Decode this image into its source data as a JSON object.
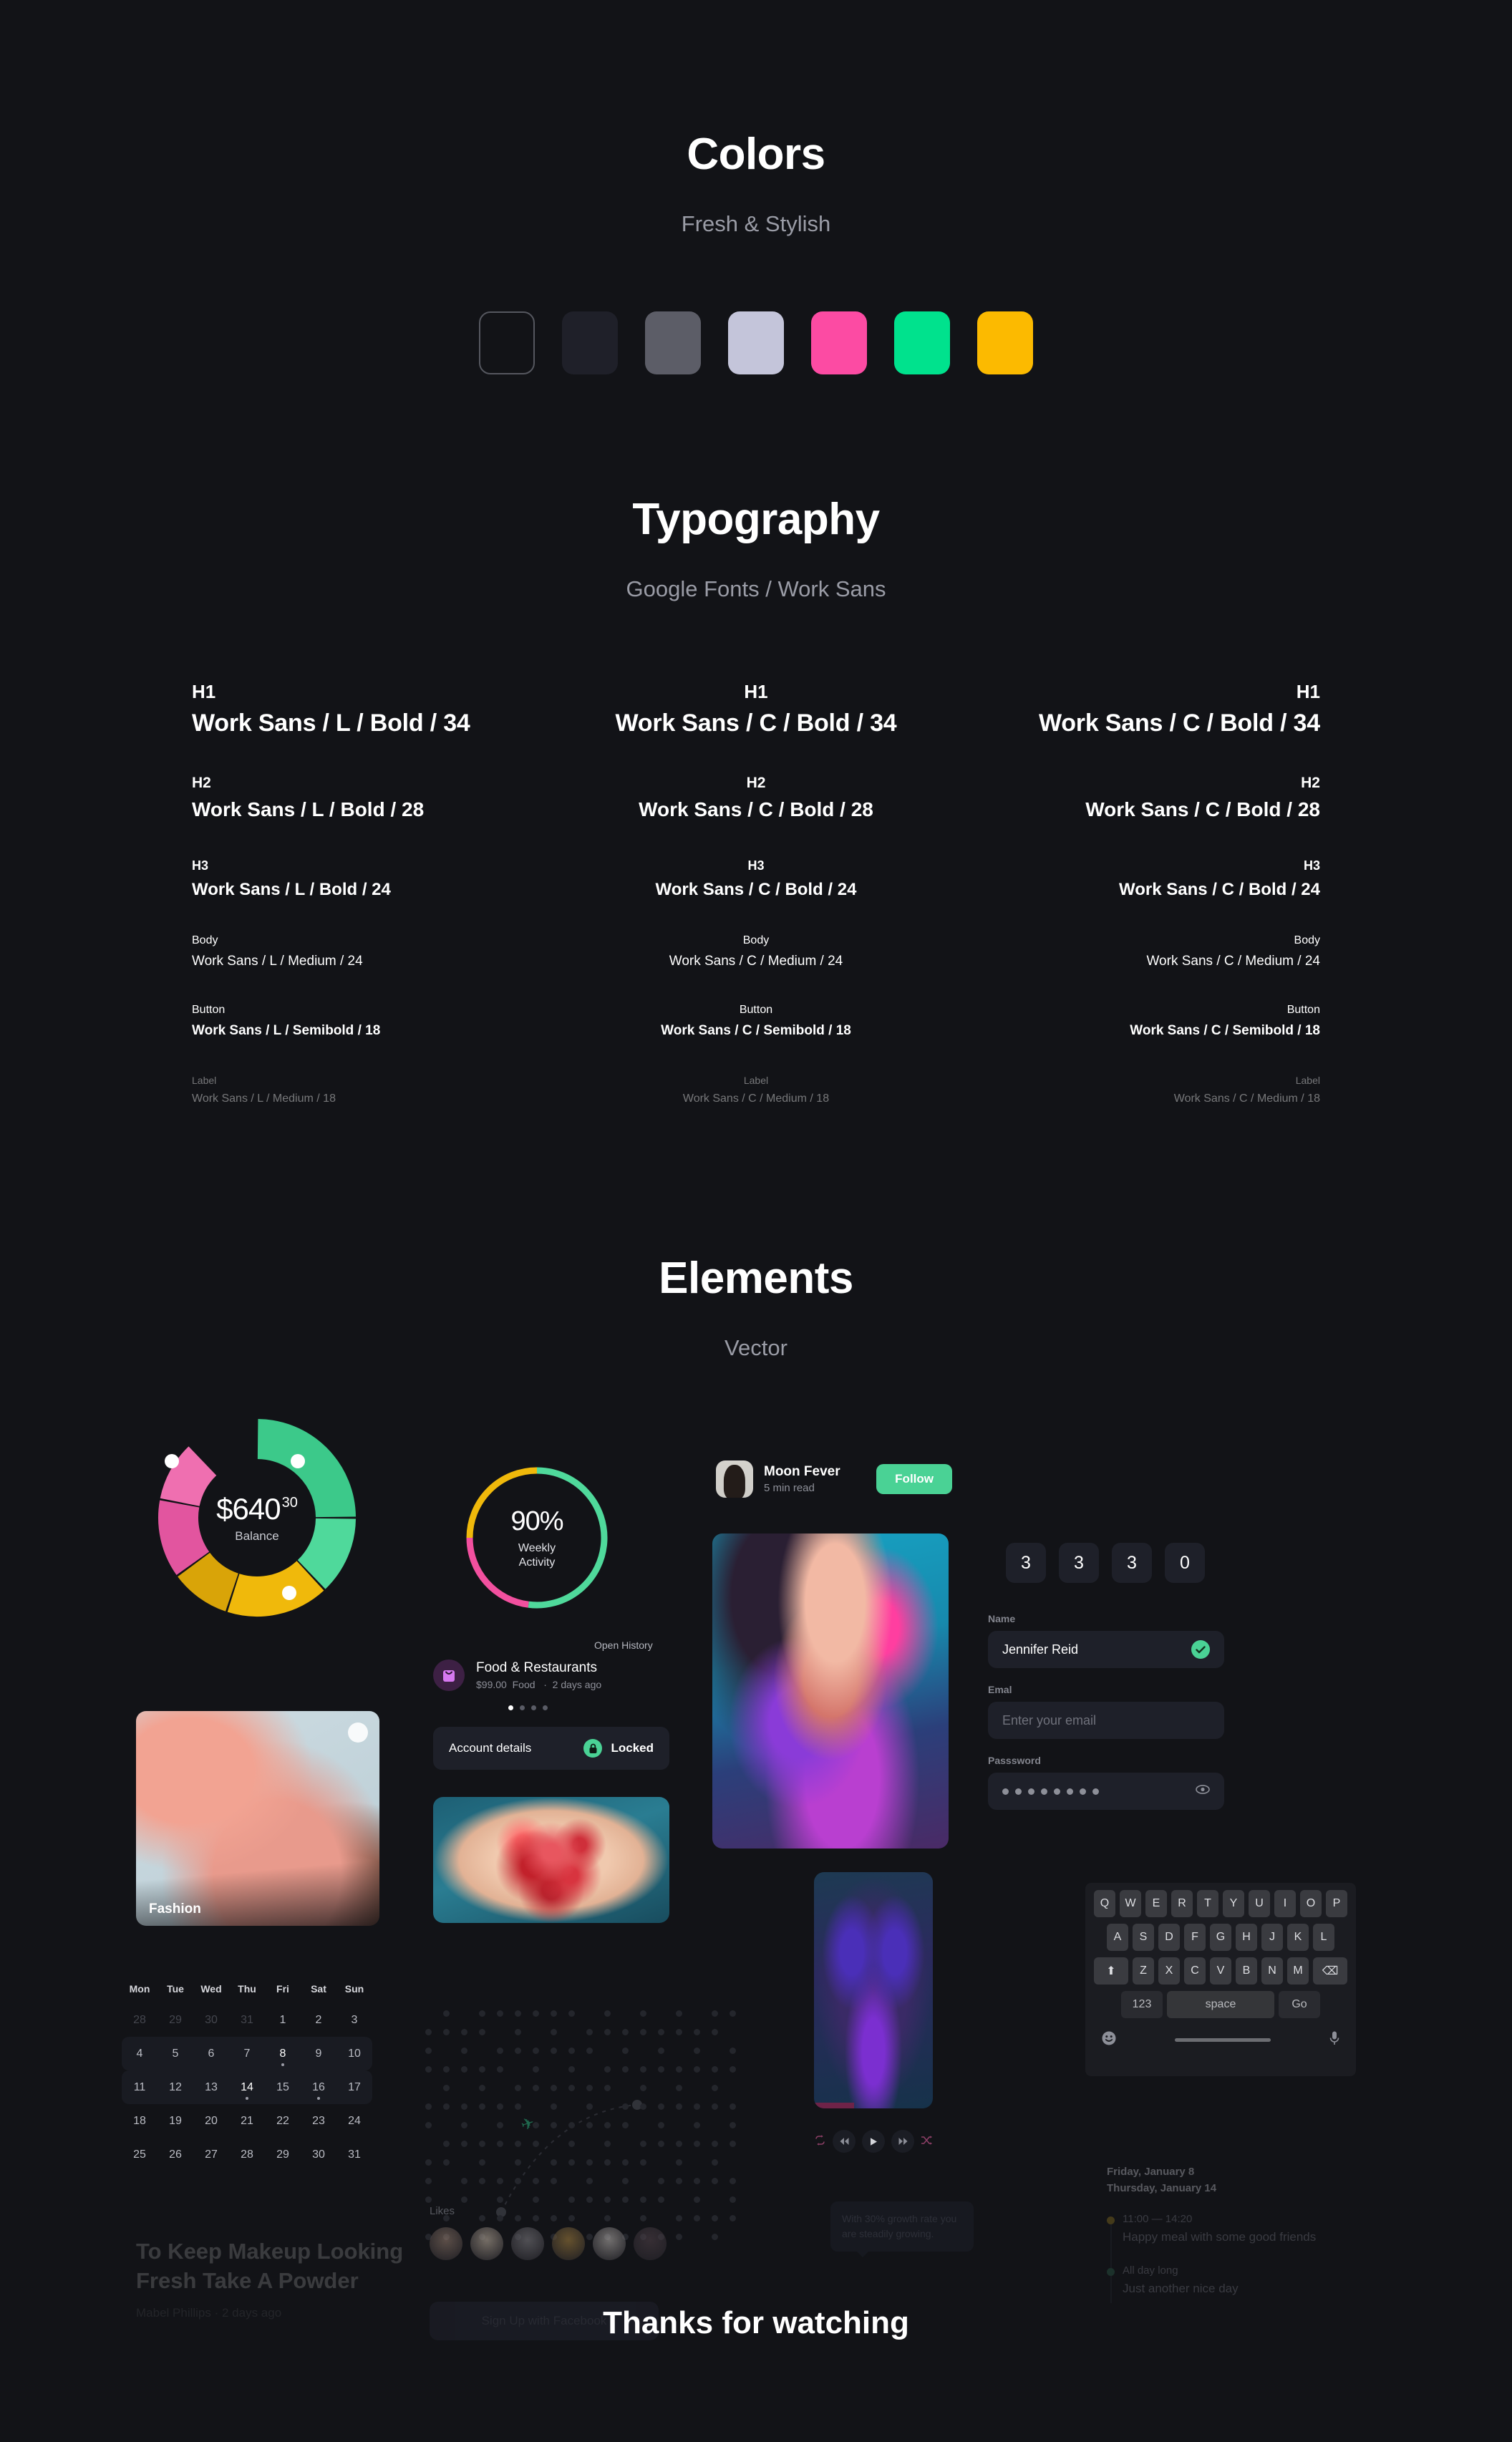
{
  "colors": {
    "title": "Colors",
    "subtitle": "Fresh & Stylish",
    "swatches": [
      {
        "name": "outline",
        "hex": "#121317"
      },
      {
        "name": "ink",
        "hex": "#1f2029"
      },
      {
        "name": "slate",
        "hex": "#5c5d67"
      },
      {
        "name": "lavender",
        "hex": "#c4c5da"
      },
      {
        "name": "pink",
        "hex": "#fc4ba3"
      },
      {
        "name": "green",
        "hex": "#00e28d"
      },
      {
        "name": "yellow",
        "hex": "#fcba00"
      }
    ]
  },
  "typography": {
    "title": "Typography",
    "subtitle": "Google Fonts / Work Sans",
    "columns": [
      {
        "align": "left",
        "items": [
          {
            "label": "H1",
            "value": "Work Sans / L / Bold / 34"
          },
          {
            "label": "H2",
            "value": "Work Sans / L / Bold / 28"
          },
          {
            "label": "H3",
            "value": "Work Sans / L / Bold / 24"
          },
          {
            "label": "Body",
            "value": "Work Sans / L / Medium / 24"
          },
          {
            "label": "Button",
            "value": "Work Sans / L / Semibold / 18"
          },
          {
            "label": "Label",
            "value": "Work Sans / L / Medium / 18"
          }
        ]
      },
      {
        "align": "center",
        "items": [
          {
            "label": "H1",
            "value": "Work Sans / C / Bold / 34"
          },
          {
            "label": "H2",
            "value": "Work Sans / C / Bold / 28"
          },
          {
            "label": "H3",
            "value": "Work Sans / C / Bold / 24"
          },
          {
            "label": "Body",
            "value": "Work Sans / C / Medium / 24"
          },
          {
            "label": "Button",
            "value": "Work Sans / C / Semibold / 18"
          },
          {
            "label": "Label",
            "value": "Work Sans / C / Medium / 18"
          }
        ]
      },
      {
        "align": "right",
        "items": [
          {
            "label": "H1",
            "value": "Work Sans / C / Bold / 34"
          },
          {
            "label": "H2",
            "value": "Work Sans / C / Bold / 28"
          },
          {
            "label": "H3",
            "value": "Work Sans / C / Bold / 24"
          },
          {
            "label": "Body",
            "value": "Work Sans / C / Medium / 24"
          },
          {
            "label": "Button",
            "value": "Work Sans / C / Semibold / 18"
          },
          {
            "label": "Label",
            "value": "Work Sans / C / Medium / 18"
          }
        ]
      }
    ]
  },
  "elements": {
    "title": "Elements",
    "subtitle": "Vector"
  },
  "balance": {
    "amount": "$640",
    "cents": "30",
    "label": "Balance",
    "segments": [
      {
        "name": "green",
        "color": "#3cc98a",
        "percent": 25
      },
      {
        "name": "mint",
        "color": "#4fd99b",
        "percent": 13
      },
      {
        "name": "yellow",
        "color": "#f0b90b",
        "percent": 17
      },
      {
        "name": "gold",
        "color": "#d9a408",
        "percent": 10
      },
      {
        "name": "pink",
        "color": "#e2559f",
        "percent": 13
      },
      {
        "name": "rose",
        "color": "#ef6fb0",
        "percent": 10
      }
    ]
  },
  "weekly": {
    "percent": "90%",
    "label_line1": "Weekly",
    "label_line2": "Activity",
    "segments": [
      {
        "name": "green",
        "color": "#4fd99b",
        "percent": 52
      },
      {
        "name": "pink",
        "color": "#f2509f",
        "percent": 23
      },
      {
        "name": "yellow",
        "color": "#f0b90b",
        "percent": 25
      }
    ]
  },
  "transaction": {
    "open_history": "Open History",
    "icon": "bag-icon",
    "title": "Food & Restaurants",
    "amount": "$99.00",
    "category": "Food",
    "separator": "·",
    "time": "2 days ago",
    "dots_total": 4,
    "dots_active": 1
  },
  "account": {
    "title": "Account details",
    "status": "Locked",
    "icon": "lock-icon"
  },
  "article": {
    "avatar": "person-avatar",
    "name": "Moon Fever",
    "meta": "5 min read",
    "follow_label": "Follow"
  },
  "otp": {
    "digits": [
      "3",
      "3",
      "3",
      "0"
    ]
  },
  "form": {
    "name_label": "Name",
    "name_value": "Jennifer Reid",
    "name_valid_icon": "check-icon",
    "email_label": "Emal",
    "email_placeholder": "Enter your email",
    "password_label": "Passsword",
    "password_dots": 8,
    "password_toggle_icon": "eye-icon"
  },
  "keyboard": {
    "row1": [
      "Q",
      "W",
      "E",
      "R",
      "T",
      "Y",
      "U",
      "I",
      "O",
      "P"
    ],
    "row2": [
      "A",
      "S",
      "D",
      "F",
      "G",
      "H",
      "J",
      "K",
      "L"
    ],
    "row3_shift": "⬆",
    "row3": [
      "Z",
      "X",
      "C",
      "V",
      "B",
      "N",
      "M"
    ],
    "row3_backspace": "⌫",
    "numbers_key": "123",
    "space_key": "space",
    "go_key": "Go",
    "emoji_icon": "emoji-icon",
    "mic_icon": "microphone-icon"
  },
  "calendar": {
    "weekdays": [
      "Mon",
      "Tue",
      "Wed",
      "Thu",
      "Fri",
      "Sat",
      "Sun"
    ],
    "weeks": [
      [
        {
          "d": "28",
          "mute": true
        },
        {
          "d": "29",
          "mute": true
        },
        {
          "d": "30",
          "mute": true
        },
        {
          "d": "31",
          "mute": true
        },
        {
          "d": "1"
        },
        {
          "d": "2"
        },
        {
          "d": "3"
        }
      ],
      [
        {
          "d": "4"
        },
        {
          "d": "5"
        },
        {
          "d": "6"
        },
        {
          "d": "7"
        },
        {
          "d": "8",
          "sel": true,
          "ev": true
        },
        {
          "d": "9"
        },
        {
          "d": "10"
        }
      ],
      [
        {
          "d": "11"
        },
        {
          "d": "12"
        },
        {
          "d": "13"
        },
        {
          "d": "14",
          "sel": true,
          "ev": true
        },
        {
          "d": "15"
        },
        {
          "d": "16",
          "ev": true
        },
        {
          "d": "17"
        }
      ],
      [
        {
          "d": "18"
        },
        {
          "d": "19"
        },
        {
          "d": "20"
        },
        {
          "d": "21"
        },
        {
          "d": "22"
        },
        {
          "d": "23"
        },
        {
          "d": "24"
        }
      ],
      [
        {
          "d": "25"
        },
        {
          "d": "26"
        },
        {
          "d": "27"
        },
        {
          "d": "28"
        },
        {
          "d": "29"
        },
        {
          "d": "30"
        },
        {
          "d": "31"
        }
      ]
    ],
    "highlight_weeks": [
      1,
      2
    ]
  },
  "fashion_card": {
    "label": "Fashion"
  },
  "makeup": {
    "title": "To Keep Makeup Looking Fresh Take A Powder",
    "meta": "Mabel Phillips · 2 days ago"
  },
  "likes": {
    "label": "Likes",
    "count": 6
  },
  "signup": {
    "label": "Sign Up with Facebook"
  },
  "player": {
    "repeat_icon": "repeat-icon",
    "rewind_icon": "rewind-icon",
    "play_icon": "play-icon",
    "forward_icon": "fast-forward-icon",
    "shuffle_icon": "shuffle-icon",
    "progress_percent": 34
  },
  "growth": {
    "text": "With 30% growth rate you are steadily growing."
  },
  "schedule": {
    "date1": "Friday, January 8",
    "date2": "Thursday, January 14",
    "items": [
      {
        "time": "11:00 — 14:20",
        "desc": "Happy meal with some good friends",
        "color": "#8a7020"
      },
      {
        "time": "All day long",
        "desc": "Just another nice day",
        "color": "#2c5b48"
      }
    ]
  },
  "footer": {
    "title": "Thanks for watching"
  }
}
